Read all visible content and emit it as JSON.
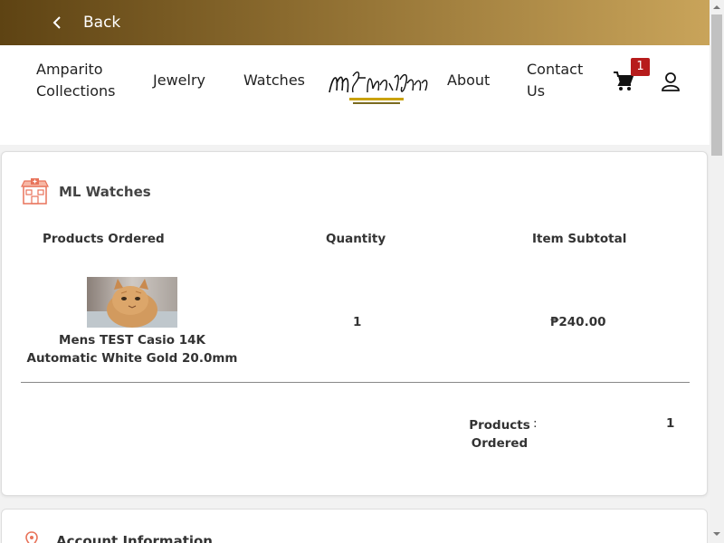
{
  "topbar": {
    "back_label": "Back"
  },
  "nav": {
    "amparito": "Amparito Collections",
    "jewelry": "Jewelry",
    "watches": "Watches",
    "about": "About",
    "contact": "Contact Us",
    "cart_count": "1"
  },
  "order": {
    "store_name": "ML Watches",
    "headers": {
      "products": "Products Ordered",
      "quantity": "Quantity",
      "subtotal": "Item Subtotal"
    },
    "item": {
      "name": "Mens TEST Casio 14K Automatic White Gold 20.0mm",
      "quantity": "1",
      "subtotal": "₱240.00"
    },
    "summary": {
      "label": "Products Ordered",
      "colon": ":",
      "value": "1"
    }
  },
  "account": {
    "title": "Account Information"
  },
  "colors": {
    "gold_dark": "#5e4313",
    "gold_light": "#c9a45a",
    "badge": "#b71c1c",
    "store_icon": "#e8735a"
  },
  "icons": {
    "back": "chevron-left-icon",
    "cart": "shopping-cart-icon",
    "user": "user-icon",
    "store": "store-icon",
    "pin": "location-pin-icon"
  }
}
